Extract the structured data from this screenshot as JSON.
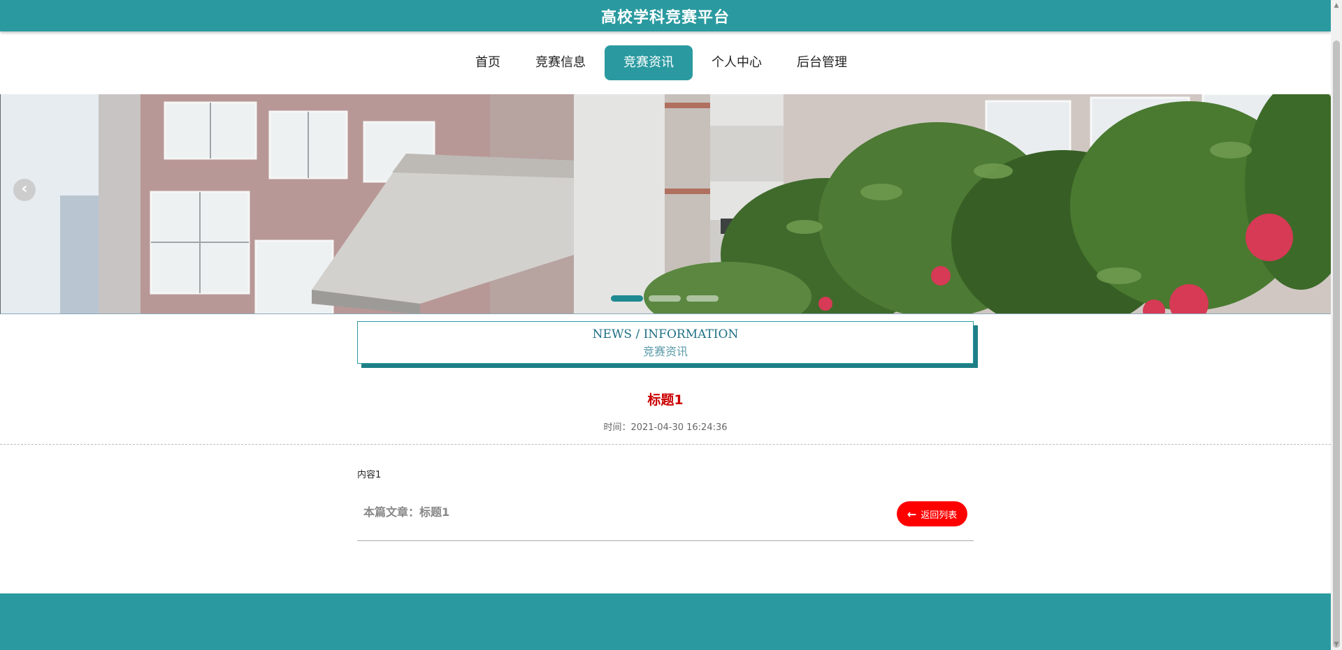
{
  "header": {
    "site_title": "高校学科竞赛平台"
  },
  "nav": {
    "items": [
      {
        "label": "首页"
      },
      {
        "label": "竞赛信息"
      },
      {
        "label": "竞赛资讯"
      },
      {
        "label": "个人中心"
      },
      {
        "label": "后台管理"
      }
    ],
    "active_index": 2
  },
  "banner": {
    "prev_icon": "‹",
    "active_slide": 1,
    "slide_count": 3
  },
  "section": {
    "title_en": "NEWS / INFORMATION",
    "title_cn": "竞赛资讯"
  },
  "article": {
    "title": "标题1",
    "time": "时间：2021-04-30 16:24:36",
    "content": "内容1",
    "footer_label": "本篇文章：标题1"
  },
  "back_button": {
    "icon": "←",
    "label": "返回列表"
  },
  "colors": {
    "accent": "#2a9aa0",
    "title_red": "#cc0000",
    "button_red": "#ff0000"
  }
}
